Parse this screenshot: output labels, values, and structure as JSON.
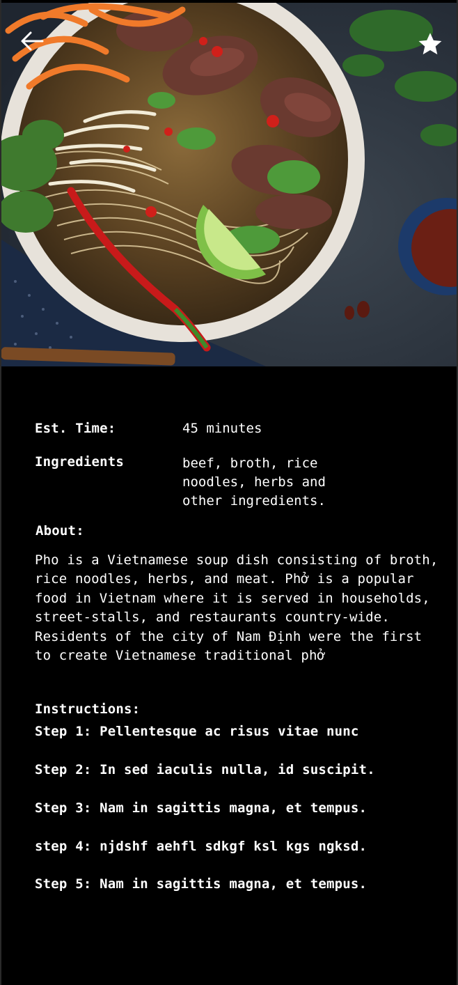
{
  "hero": {
    "image_alt": "Bowl of pho with beef, rice noodles, herbs, lime and chili",
    "back_icon": "arrow-left-icon",
    "favorite_icon": "star-icon"
  },
  "details": {
    "time_label": "Est. Time:",
    "time_value": "45 minutes",
    "ingredients_label": "Ingredients",
    "ingredients_value": "beef, broth, rice\nnoodles, herbs and\nother ingredients.",
    "about_label": "About:",
    "about_text": "Pho is a Vietnamese soup dish consisting of broth, rice noodles, herbs, and meat. Phở is a popular food in Vietnam where it is served in households, street-stalls, and restaurants country-wide. Residents of the city of Nam Định were the first to create Vietnamese traditional phở",
    "instructions_label": "Instructions:"
  },
  "steps": [
    "Step 1: Pellentesque ac risus vitae nunc",
    "Step 2: In sed iaculis nulla, id suscipit.",
    "Step 3: Nam in sagittis magna, et tempus.",
    "step 4: njdshf aehfl sdkgf ksl kgs ngksd.",
    "Step 5: Nam in sagittis magna, et tempus."
  ],
  "colors": {
    "background": "#000000",
    "text": "#ffffff"
  }
}
